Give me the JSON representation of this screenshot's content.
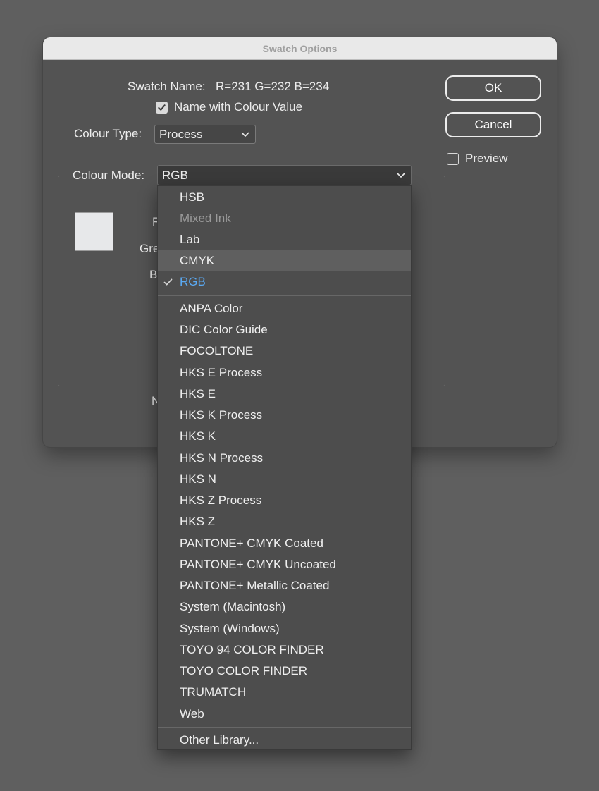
{
  "dialog": {
    "title": "Swatch Options",
    "swatch_name_label": "Swatch Name:",
    "swatch_name_value": "R=231 G=232 B=234",
    "name_with_colour_value_label": "Name with Colour Value",
    "name_with_colour_value_checked": true,
    "colour_type_label": "Colour Type:",
    "colour_type_value": "Process",
    "colour_mode_label": "Colour Mode:",
    "colour_mode_value": "RGB",
    "preview_label": "Preview",
    "preview_checked": false,
    "swatch_color": "#e7e8ea",
    "partial_labels": {
      "red": "R",
      "green": "Gre",
      "blue": "B",
      "note": "N"
    }
  },
  "buttons": {
    "ok": "OK",
    "cancel": "Cancel"
  },
  "colour_mode_menu": {
    "items": [
      {
        "label": "HSB",
        "state": "normal"
      },
      {
        "label": "Mixed Ink",
        "state": "disabled"
      },
      {
        "label": "Lab",
        "state": "normal"
      },
      {
        "label": "CMYK",
        "state": "hover"
      },
      {
        "label": "RGB",
        "state": "checked"
      },
      {
        "label": "ANPA Color",
        "state": "normal"
      },
      {
        "label": "DIC Color Guide",
        "state": "normal"
      },
      {
        "label": "FOCOLTONE",
        "state": "normal"
      },
      {
        "label": "HKS E Process",
        "state": "normal"
      },
      {
        "label": "HKS E",
        "state": "normal"
      },
      {
        "label": "HKS K Process",
        "state": "normal"
      },
      {
        "label": "HKS K",
        "state": "normal"
      },
      {
        "label": "HKS N Process",
        "state": "normal"
      },
      {
        "label": "HKS N",
        "state": "normal"
      },
      {
        "label": "HKS Z Process",
        "state": "normal"
      },
      {
        "label": "HKS Z",
        "state": "normal"
      },
      {
        "label": "PANTONE+ CMYK Coated",
        "state": "normal"
      },
      {
        "label": "PANTONE+ CMYK Uncoated",
        "state": "normal"
      },
      {
        "label": "PANTONE+ Metallic Coated",
        "state": "normal"
      },
      {
        "label": "System (Macintosh)",
        "state": "normal"
      },
      {
        "label": "System (Windows)",
        "state": "normal"
      },
      {
        "label": "TOYO 94 COLOR FINDER",
        "state": "normal"
      },
      {
        "label": "TOYO COLOR FINDER",
        "state": "normal"
      },
      {
        "label": "TRUMATCH",
        "state": "normal"
      },
      {
        "label": "Web",
        "state": "normal"
      },
      {
        "label": "Other Library...",
        "state": "normal"
      }
    ]
  },
  "colors": {
    "checked_item": "#5aa9f2",
    "background": "#5f5f5f",
    "dialog": "#535353"
  }
}
